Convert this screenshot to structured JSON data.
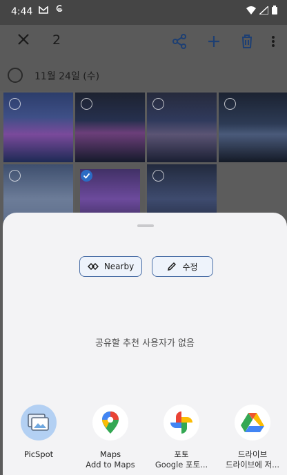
{
  "status_bar": {
    "time": "4:44",
    "left_icons": [
      "gmail-icon",
      "sync-icon"
    ],
    "right_icons": [
      "wifi-icon",
      "signal-icon",
      "battery-icon"
    ]
  },
  "app_bar": {
    "selected_count": "2"
  },
  "section": {
    "date": "11월 24일 (수)"
  },
  "photos": [
    {
      "selected": false
    },
    {
      "selected": false
    },
    {
      "selected": false
    },
    {
      "selected": false
    },
    {
      "selected": false
    },
    {
      "selected": true
    },
    {
      "selected": false
    }
  ],
  "share_sheet": {
    "chips": [
      {
        "label": "Nearby",
        "icon": "nearby-icon"
      },
      {
        "label": "수정",
        "icon": "pencil-icon"
      }
    ],
    "empty_message": "공유할 추천 사용자가 없음",
    "apps": [
      {
        "name": "PicSpot",
        "sub": "",
        "icon": "picspot-icon"
      },
      {
        "name": "Maps",
        "sub": "Add to Maps",
        "icon": "maps-icon"
      },
      {
        "name": "포토",
        "sub": "Google 포토...",
        "icon": "photos-icon"
      },
      {
        "name": "드라이브",
        "sub": "드라이브에 저...",
        "icon": "drive-icon"
      }
    ]
  }
}
